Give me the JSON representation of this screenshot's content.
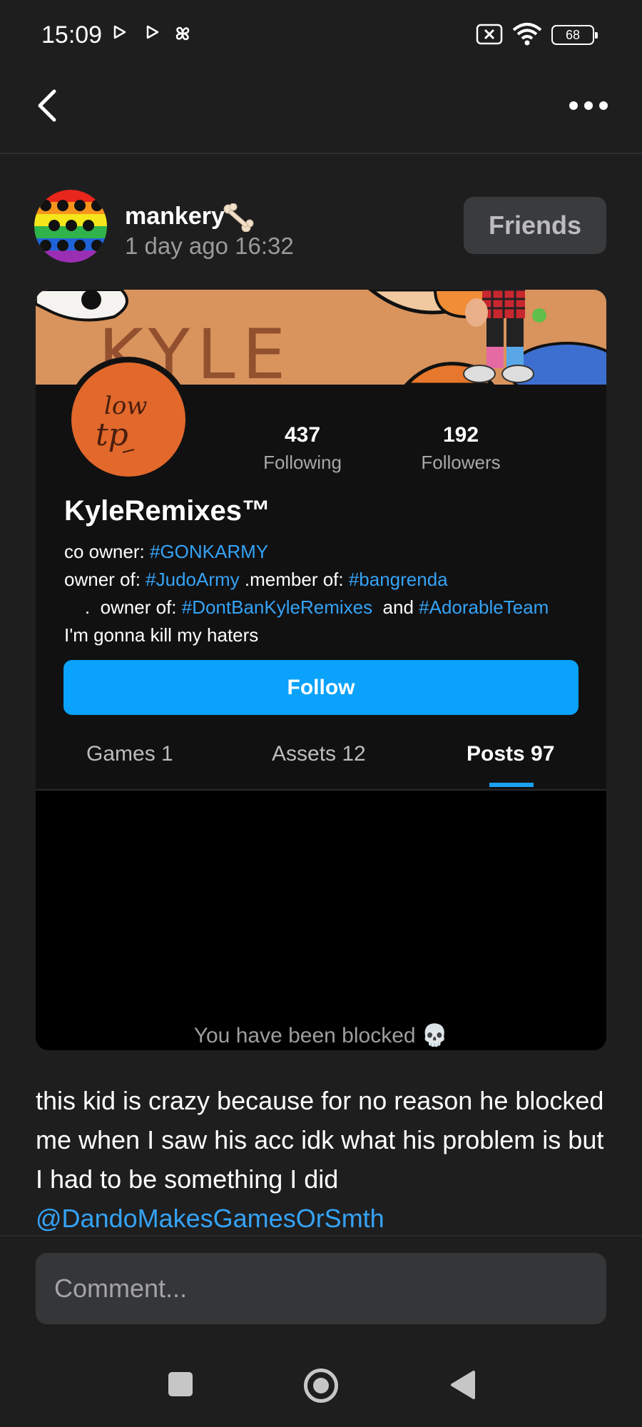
{
  "status_bar": {
    "time": "15:09",
    "battery": "68"
  },
  "post": {
    "author": "mankery",
    "time": "1 day ago 16:32",
    "friends_label": "Friends",
    "body_text": "this kid is crazy because for no reason he blocked me when I saw his acc idk what his problem is but I had to be something I did",
    "mention": "@DandoMakesGamesOrSmth"
  },
  "profile": {
    "avatar_scribble_line1": "low",
    "avatar_scribble_line2": "tp",
    "banner_text": "KYLE",
    "name": "KyleRemixes™",
    "following_count": "437",
    "following_label": "Following",
    "followers_count": "192",
    "followers_label": "Followers",
    "bio": {
      "co_owner_label": "co owner: ",
      "co_owner_tag": "#GONKARMY",
      "owner_of_label": "owner of: ",
      "owner_of_tag": "#JudoArmy",
      "member_of_label": " .member of: ",
      "member_of_tag": "#bangrenda",
      "owner2_label": "    .  owner of: ",
      "owner2_tag1": "#DontBanKyleRemixes",
      "and_label": "  and ",
      "owner2_tag2": "#AdorableTeam",
      "last_line": "I'm gonna kill my haters"
    },
    "follow_label": "Follow",
    "tabs": [
      {
        "label": "Games 1"
      },
      {
        "label": "Assets 12"
      },
      {
        "label": "Posts 97"
      }
    ],
    "blocked_message": "You have been blocked",
    "blocked_emoji": "💀"
  },
  "comment": {
    "placeholder": "Comment..."
  },
  "colors": {
    "accent": "#0aa2fb",
    "link": "#35a3f5",
    "background": "#1e1e1f"
  }
}
